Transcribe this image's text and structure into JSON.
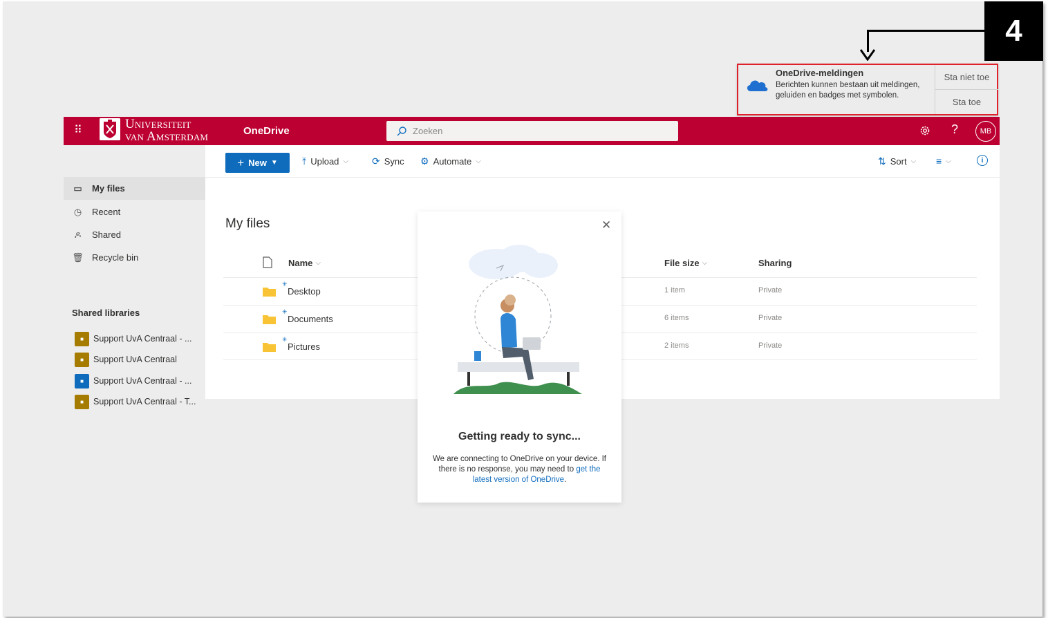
{
  "step_marker": "4",
  "notification": {
    "title": "OneDrive-meldingen",
    "body": "Berichten kunnen bestaan uit meldingen, geluiden en badges met symbolen.",
    "deny_label": "Sta niet toe",
    "allow_label": "Sta toe",
    "icon": "onedrive-cloud-icon"
  },
  "header": {
    "logo_line1": "Universiteit",
    "logo_line2": "van Amsterdam",
    "app_name": "OneDrive",
    "search_placeholder": "Zoeken",
    "avatar_initials": "MB",
    "help_label": "?",
    "brand_color": "#bc0031"
  },
  "commandbar": {
    "new_label": "New",
    "upload_label": "Upload",
    "sync_label": "Sync",
    "automate_label": "Automate",
    "sort_label": "Sort"
  },
  "leftnav": {
    "items": [
      {
        "label": "My files",
        "icon": "folder-icon"
      },
      {
        "label": "Recent",
        "icon": "clock-icon"
      },
      {
        "label": "Shared",
        "icon": "people-icon"
      },
      {
        "label": "Recycle bin",
        "icon": "trash-icon"
      }
    ],
    "libraries_heading": "Shared libraries",
    "libraries": [
      {
        "label": "Support UvA Centraal - ...",
        "color": "#a67c00"
      },
      {
        "label": "Support UvA Centraal",
        "color": "#a67c00"
      },
      {
        "label": "Support UvA Centraal - ...",
        "color": "#0f6cbd"
      },
      {
        "label": "Support UvA Centraal - T...",
        "color": "#a67c00"
      }
    ]
  },
  "main": {
    "heading": "My files",
    "columns": {
      "name": "Name",
      "file_size": "File size",
      "sharing": "Sharing"
    },
    "rows": [
      {
        "name": "Desktop",
        "size": "1 item",
        "sharing": "Private"
      },
      {
        "name": "Documents",
        "size": "6 items",
        "sharing": "Private"
      },
      {
        "name": "Pictures",
        "size": "2 items",
        "sharing": "Private"
      }
    ]
  },
  "dialog": {
    "title": "Getting ready to sync...",
    "text": "We are connecting to OneDrive on your device. If there is no response, you may need to ",
    "link": "get the latest version of OneDrive",
    "text_end": "."
  }
}
